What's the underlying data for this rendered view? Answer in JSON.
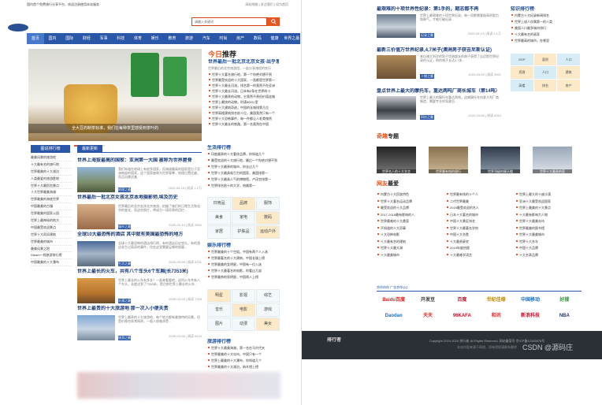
{
  "top": {
    "announce": "国内首个免费旅行分享平台，欢迎注册使用本站服务",
    "links": "网站地图 | 关注我们 | 设为首页"
  },
  "search": {
    "placeholder": "请输入关键词"
  },
  "nav": [
    "首页",
    "国内",
    "国际",
    "财经",
    "军事",
    "科技",
    "体育",
    "娱乐",
    "教育",
    "旅游",
    "汽车",
    "时尚",
    "房产",
    "数码",
    "健康",
    "世界之最"
  ],
  "hero": {
    "caption": "全大豆的制茶标准，我们在每种茶里感受到茶叶的"
  },
  "jinri": {
    "brand": "今日",
    "brand2": "推荐",
    "headline": "世界最后一批北京北京女孩·出乎意料",
    "summary": "世界最后的北京旅游团，一起分享旅程的欢乐",
    "items": [
      "世界十大著名旅行地，第一个你绝对想不到",
      "世界最受欢迎的十大国家，一直都是世界第一",
      "世界十大最长河流，排名第一的竟然不在亚洲",
      "世界十大最长河流，日本有2条在世界前十",
      "世界十大最贵的动物，它竟然不贵但价值连城",
      "世界上最快的动物，时速800公里",
      "世界十大建筑奇迹，中国的长城排第几位",
      "世界高楼建筑排名前十位，美国竟然只有一个",
      "世界十大恐怖事件，每一件都让人毛骨悚然",
      "世界十大最长的铁路，第一名竟然在中国"
    ]
  },
  "sidebar": {
    "title": "图说排行榜",
    "items": [
      "最美风景的旅游地",
      "十大最有名的旅行地",
      "世界最美的十大湖泊",
      "人类最爱的旅游胜地",
      "世界十大最危险景点",
      "十大世界最美海滩",
      "世界最美的海底世界",
      "中国最美的古镇",
      "世界最美的国家公园",
      "世界上最神秘的地方",
      "中国最受欢迎景点",
      "世界十大奇异建筑",
      "世界最美的城市",
      "最美风景之地",
      "Steam一线旅游排行榜",
      "中国最美的十大瀑布"
    ]
  },
  "feed": {
    "tab": "最新更新",
    "articles": [
      {
        "title": "世界上海拔最高的国家：亚洲第一大国 被称为世界屋脊",
        "summary": "我们知道在地球上有很多国家，而海拔最高的国家是位于亚洲南部的国家，这个国家被称为世界屋脊，地理位置优越，而且风景优美...",
        "tag": "地理之最",
        "meta": "2020-03-10 | 阅读 1.2万"
      },
      {
        "title": "世界最后一批北京女孩北京本地摄影师,埃及历史",
        "summary": "世界最后的北京女孩北京旅游，拍摄了她们的日常生活和北京的变化，而这些照片，将成为一段珍贵的回忆...",
        "tag": "城市之最",
        "meta": "2020-03-10 | 阅读 9562"
      },
      {
        "title": "全球10大最恐怖的酒店 其中就有美国最恐怖的地方",
        "summary": "全球十大最恐怖的酒店排行榜，有的酒店历史悠久，有的酒店发生过离奇的事件，住在这里需要足够的胆量...",
        "tag": "生活之最",
        "meta": "2020-03-09 | 阅读 8731"
      },
      {
        "title": "世界上最长的火车，共有八个车头6个车厢(长7353米)",
        "summary": "世界上最长的火车有多长？一起来看看吧，这列火车共有八个车头，长度达到了7353米，是目前世界上最长的火车...",
        "tag": "交通之最",
        "meta": "2020-03-09 | 阅读 7215"
      },
      {
        "title": "世界上最贵的十大旅游地 那一次入小便夫贵",
        "summary": "世界上最贵的十大旅游地，每个地方都有着独特的风景，但是价格也非常昂贵，一般人很难承受...",
        "tag": "旅游之最",
        "meta": "2020-03-08 | 阅读 6104"
      }
    ]
  },
  "mid": {
    "rank_title": "生活排行榜",
    "rank_items": [
      "印度最贵的十大奢侈品牌，你知道几个",
      "最受欢迎的十大旅行地，最后一个你绝对想不到",
      "世界十大最贵的城市，你去过几个",
      "世界十大最具吸引力的国家，美国排第一",
      "世界十大最具人气的博物馆，卢浮宫排第一",
      "世界排名前十的大学，哈佛第一"
    ],
    "grid1": [
      "日用品",
      "品牌",
      "服饰",
      "美食",
      "家电",
      "数码",
      "家居",
      "护肤品",
      "运动户外"
    ],
    "rank2_title": "娱乐排行榜",
    "rank2_items": [
      "世界最美的十个空姐，中国有两个人入选",
      "世界最著名的十大建筑，中国长城上榜",
      "世界最美的女明星，中国有一位入选",
      "世界十大最著名的电影，你看过几部",
      "世界最帅的男明星，中国两人上榜"
    ],
    "grid2": [
      "明星",
      "影视",
      "综艺",
      "音乐",
      "电影",
      "游戏",
      "图片",
      "动漫",
      "美女"
    ],
    "rank3_title": "旅游排行榜",
    "rank3_items": [
      "世界十大最美海滩，第一名在马尔代夫",
      "世界最美的十大岛屿，中国只有一个",
      "世界上最美的十大瀑布，你知道几个",
      "世界最美的十大湖泊，纳木错上榜"
    ]
  },
  "right": {
    "articles": [
      {
        "title": "最艰难的十项世界性纪录：第1手的，期志都不再",
        "summary": "世界上最艰难的十项世界纪录，每一项都需要极高的毅力和勇气，才能打破纪录...",
        "tag": "纪录之最",
        "meta": "2020-03-10 | 阅读 1.1万"
      },
      {
        "title": "最新三价值万世界纪录,4,7米子(澳洲男子获吉尼斯认证)",
        "summary": "来自澳大利亚的男子凭借超长的胡子获得了吉尼斯世界纪录的认证，他的胡子长达4.7米...",
        "tag": "人物之最",
        "meta": "2020-03-09 | 阅读 9521"
      },
      {
        "title": "盘点世界上最大的摩托车，重达两吨厂商长城车（第14吨）",
        "summary": "世界上最大的摩托车重达两吨，这辆摩托车由意大利厂商制造，需要专业的驾驶员...",
        "tag": "科技之最",
        "meta": "2020-03-08 | 阅读 8310"
      }
    ],
    "side_title": "知识排行榜",
    "side_items": [
      "内蒙古十大纪录新闻排名",
      "世界上成人仅属第一的人类",
      "美国人口最多城市排行",
      "十大最有名的画家",
      "世界最高的城市，在哪里"
    ],
    "side_grid": [
      "GDP",
      "面积",
      "人口",
      "资源",
      "人口",
      "建筑",
      "高楼",
      "排名",
      "房产"
    ],
    "zt_brand": "奇趣",
    "zt_brand2": "专题",
    "zt_items": [
      "世界名人的十大名言",
      "世界最有钱的银行",
      "世界顶级的摩天楼",
      "世界十大最贵的家"
    ],
    "wy_brand": "网友",
    "wy_brand2": "最爱",
    "wy_items": [
      [
        "内蒙古十大民族特色",
        "世界最有钱的十个人",
        "世界上最大的十座沙漠"
      ],
      [
        "世界十大著名运动品牌",
        "二代世界最美",
        "亚洲十大最受欢迎国家"
      ],
      [
        "最受欢迎的十大品牌",
        "2019最受欢迎的名人",
        "世界上最美的十大景点"
      ],
      [
        "2017-2018最有影响的人",
        "日本十大著名的城市",
        "十大最有影响力人物"
      ],
      [
        "世界最难的十大悬案",
        "中国十大景区排名",
        "世界十大最美岛屿"
      ],
      [
        "不知道的十大奇事",
        "世界十大最著名学府",
        "世界最美的图书馆"
      ],
      [
        "十大恐怖电影",
        "中国十大名胜",
        "世界十大最美城市"
      ],
      [
        "十大最有名的建筑",
        "十大最贵豪宅",
        "世界十大名车"
      ],
      [
        "世界十大最大湖",
        "2019年度热搜",
        "中国十大品牌"
      ],
      [
        "十大最美城市",
        "十大最难学语言",
        "十大名表品牌"
      ]
    ],
    "friends_label": "合作伙伴   广告合作QQ",
    "partners": [
      "Baidu百度",
      "开发豆",
      "百度",
      "世纪佳缘",
      "中国移动",
      "好搜",
      "Daodao",
      "天天",
      "96KAFA",
      "和讯",
      "新浪科技",
      "NBA"
    ],
    "footer_logo": "排行者",
    "footer_line1": "Copyright 2019-2020 排行者 All Rights Reserved. 网站备案号 京ICP备12345678号",
    "footer_line2": "本站内容来源于网络，如有侵权请联系删除"
  },
  "watermark": "CSDN @源码庄",
  "colors": {
    "accent": "#e8561f",
    "nav": "#2a57a8",
    "footer": "#2b2f36"
  }
}
